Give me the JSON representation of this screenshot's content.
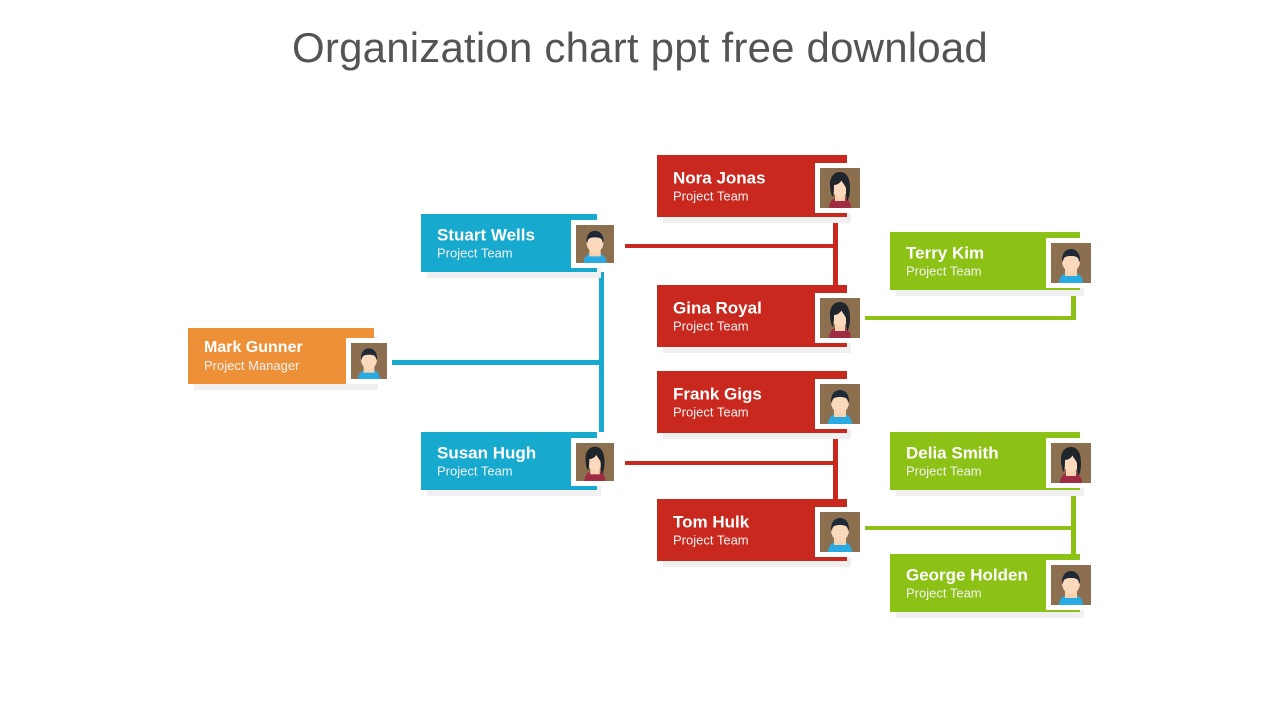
{
  "title": "Organization chart ppt free download",
  "colors": {
    "orange": "#ED9038",
    "blue": "#17A9CE",
    "red": "#C8281E",
    "green": "#8CC115",
    "title_text": "#545454",
    "node_text": "#FFFFFF",
    "avatar_background": "#8C6F4F"
  },
  "nodes": {
    "root": {
      "name": "Mark Gunner",
      "role": "Project Manager",
      "color": "#ED9038",
      "avatar": "male-avatar-icon"
    },
    "managers": [
      {
        "name": "Stuart Wells",
        "role": "Project Team",
        "color": "#17A9CE",
        "avatar": "male-avatar-icon"
      },
      {
        "name": "Susan Hugh",
        "role": "Project Team",
        "color": "#17A9CE",
        "avatar": "female-avatar-icon"
      }
    ],
    "team_red": [
      {
        "name": "Nora Jonas",
        "role": "Project Team",
        "color": "#C8281E",
        "avatar": "female-avatar-icon"
      },
      {
        "name": "Gina Royal",
        "role": "Project Team",
        "color": "#C8281E",
        "avatar": "female-avatar-icon"
      },
      {
        "name": "Frank Gigs",
        "role": "Project Team",
        "color": "#C8281E",
        "avatar": "male-avatar-icon"
      },
      {
        "name": "Tom Hulk",
        "role": "Project Team",
        "color": "#C8281E",
        "avatar": "male-avatar-icon"
      }
    ],
    "team_green": [
      {
        "name": "Terry Kim",
        "role": "Project Team",
        "color": "#8CC115",
        "avatar": "male-avatar-icon"
      },
      {
        "name": "Delia Smith",
        "role": "Project Team",
        "color": "#8CC115",
        "avatar": "female-avatar-icon"
      },
      {
        "name": "George Holden",
        "role": "Project Team",
        "color": "#8CC115",
        "avatar": "male-avatar-icon"
      }
    ]
  }
}
